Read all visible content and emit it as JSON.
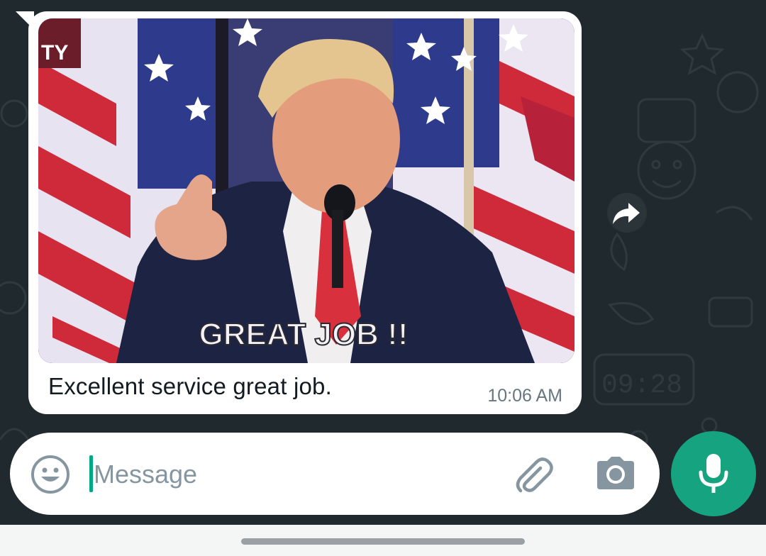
{
  "message": {
    "caption": "Excellent service great job.",
    "time": "10:06 AM",
    "media": {
      "corner_text": "TY",
      "overlay_text": "GREAT JOB !!"
    }
  },
  "composer": {
    "placeholder": "Message",
    "value": ""
  },
  "icons": {
    "emoji": "emoji-icon",
    "attach": "paperclip-icon",
    "camera": "camera-icon",
    "mic": "microphone-icon",
    "forward": "forward-arrow-icon"
  },
  "colors": {
    "chat_background": "#202a2e",
    "bubble": "#ffffff",
    "accent": "#15a47f",
    "secondary_text": "#667781"
  }
}
